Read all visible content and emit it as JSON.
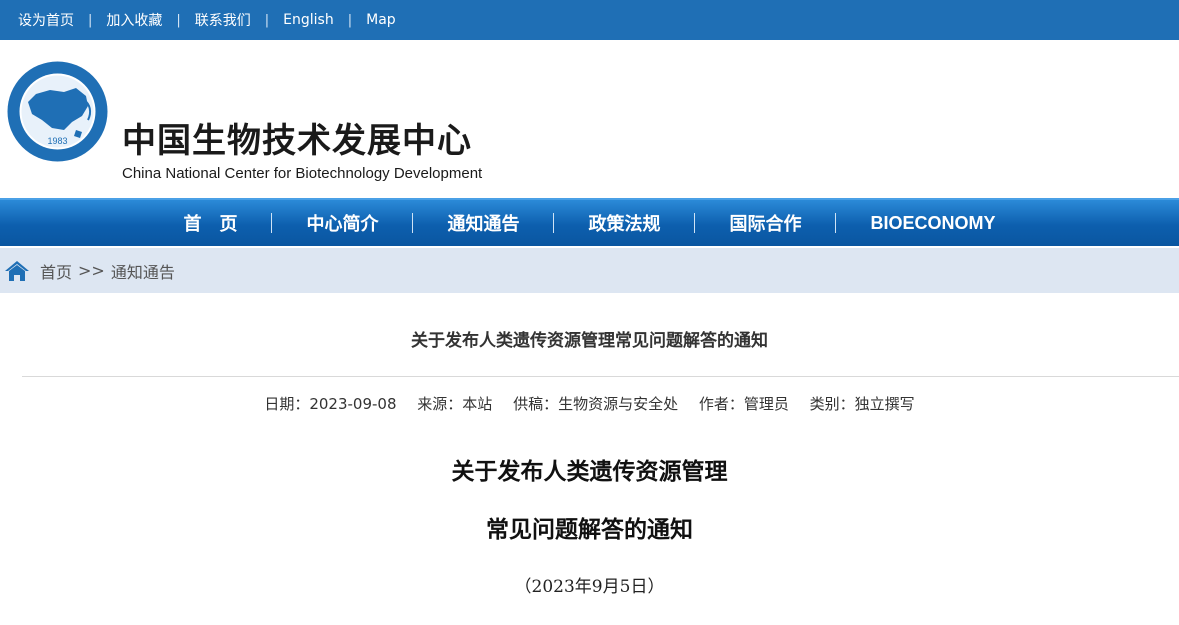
{
  "topbar": {
    "links": [
      "设为首页",
      "加入收藏",
      "联系我们",
      "English",
      "Map"
    ]
  },
  "header": {
    "logo_cn": "中国生物技术发展中心",
    "logo_en": "China National Center for Biotechnology Development",
    "seal_year": "1983"
  },
  "nav": {
    "items": [
      "首　页",
      "中心简介",
      "通知通告",
      "政策法规",
      "国际合作",
      "BIOECONOMY"
    ]
  },
  "breadcrumb": {
    "home": "首页",
    "separator": ">>",
    "current": "通知通告"
  },
  "article": {
    "title": "关于发布人类遗传资源管理常见问题解答的通知",
    "meta": {
      "date": "日期：2023-09-08",
      "source": "来源：本站",
      "contributor": "供稿：生物资源与安全处",
      "author": "作者：管理员",
      "category": "类别：独立撰写"
    },
    "heading_line1": "关于发布人类遗传资源管理",
    "heading_line2": "常见问题解答的通知",
    "issue_date": "（2023年9月5日）"
  },
  "colors": {
    "topbar": "#1f6fb5",
    "nav": "#0d5fae",
    "breadcrumb_bg": "#dde6f2",
    "home_icon": "#1f6fb5"
  }
}
